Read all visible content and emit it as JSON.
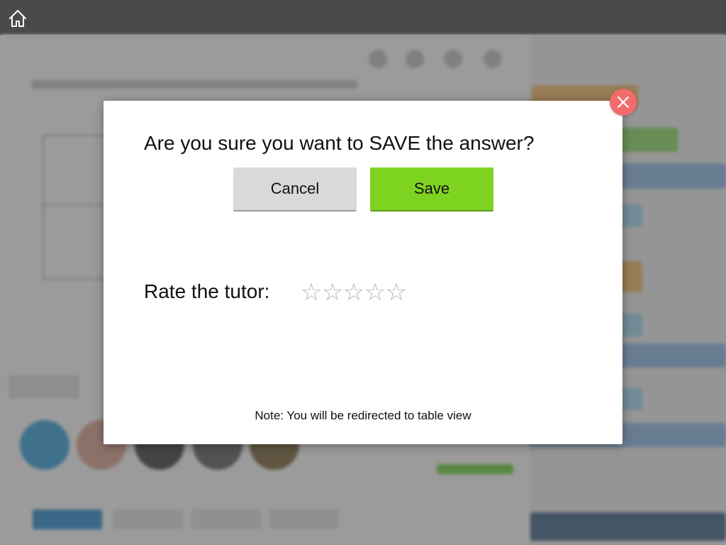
{
  "app": {
    "home_icon": "home-icon"
  },
  "modal": {
    "title": "Are you sure you want to SAVE the answer?",
    "cancel_label": "Cancel",
    "save_label": "Save",
    "rate_label": "Rate the tutor:",
    "rating": {
      "value": 0,
      "max": 5,
      "star_glyph": "☆"
    },
    "note": "Note: You will be redirected to table view",
    "close_icon": "close-icon"
  },
  "colors": {
    "topbar": "#4a4a4a",
    "save_button": "#7ed321",
    "cancel_button": "#d9d9d9",
    "close_button": "#f26b6b"
  }
}
